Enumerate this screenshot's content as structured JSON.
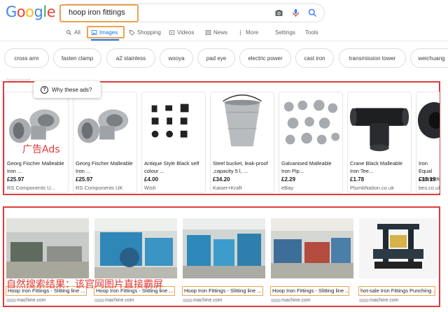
{
  "logo": {
    "letters": [
      "G",
      "o",
      "o",
      "g",
      "l",
      "e"
    ],
    "colors": [
      "#4285f4",
      "#ea4335",
      "#fbbc05",
      "#4285f4",
      "#34a853",
      "#ea4335"
    ]
  },
  "search": {
    "query": "hoop iron fittings"
  },
  "nav": {
    "all": "All",
    "images": "Images",
    "shopping": "Shopping",
    "videos": "Videos",
    "news": "News",
    "more": "More",
    "settings": "Settings",
    "tools": "Tools"
  },
  "chips": [
    "cross arm",
    "fasten clamp",
    "a2 stainless",
    "wooya",
    "pad eye",
    "electric power",
    "cast iron",
    "transmission tower",
    "weichuang"
  ],
  "ads": {
    "sponsored": "Sponsored",
    "why": "Why these ads?",
    "annotation": "广告Ads",
    "items": [
      {
        "title": "Georg Fischer Malleable Iron ...",
        "price": "£25.97",
        "store": "RS Components U..."
      },
      {
        "title": "Georg Fischer Malleable Iron ...",
        "price": "£25.97",
        "store": "RS Components UK"
      },
      {
        "title": "Antique Style Black self colour ...",
        "price": "£4.00",
        "store": "Wish"
      },
      {
        "title": "Steel bucket, leak-proof ,capacity 5 l, ...",
        "price": "£34.20",
        "store": "Kaiser+Kraft"
      },
      {
        "title": "Galvanised Malleable Iron Pip...",
        "price": "£2.29",
        "store": "eBay"
      },
      {
        "title": "Crane Black Malleable Iron Tee...",
        "price": "£1.78",
        "store": "PlumbNation.co.uk"
      },
      {
        "title": "Iron Equal Connector...",
        "price": "£13.19",
        "store": "bes.co.uk"
      }
    ]
  },
  "organic": {
    "annotation": "自然搜索结果：该官网图片直接霸屏",
    "items": [
      {
        "title": "Hoop Iron Fittings - Slitting line ...",
        "source": "machine.com"
      },
      {
        "title": "Hoop Iron Fittings - Slitting line ...",
        "source": "machine.com"
      },
      {
        "title": "Hoop Iron Fittings - Slitting line ...",
        "source": "machine.com"
      },
      {
        "title": "Hoop Iron Fittings - Slitting line ...",
        "source": "machine.com"
      },
      {
        "title": "hot-sale Iron Fittings Punching ...",
        "source": "machine.com"
      }
    ]
  }
}
